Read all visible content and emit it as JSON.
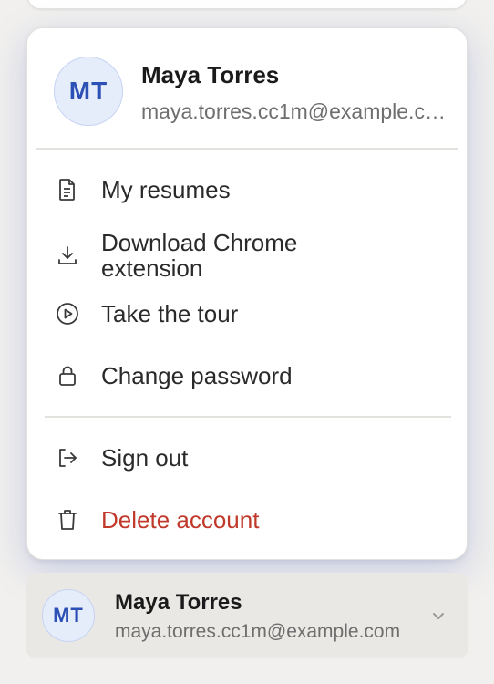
{
  "account": {
    "initials": "MT",
    "name": "Maya Torres",
    "email": "maya.torres.cc1m@example.com"
  },
  "menu": {
    "items": [
      {
        "label": "My resumes",
        "icon": "document-icon"
      },
      {
        "label": "Download Chrome extension",
        "icon": "download-icon"
      },
      {
        "label": "Take the tour",
        "icon": "play-circle-icon"
      },
      {
        "label": "Change password",
        "icon": "lock-icon"
      }
    ],
    "footer_items": [
      {
        "label": "Sign out",
        "icon": "sign-out-icon"
      },
      {
        "label": "Delete account",
        "icon": "trash-icon",
        "danger": true
      }
    ]
  },
  "colors": {
    "avatar_bg": "#e6edfa",
    "avatar_text": "#2c50b5",
    "danger": "#c0392b",
    "text_primary": "#1a1a1a",
    "text_secondary": "#6e6e6e"
  }
}
